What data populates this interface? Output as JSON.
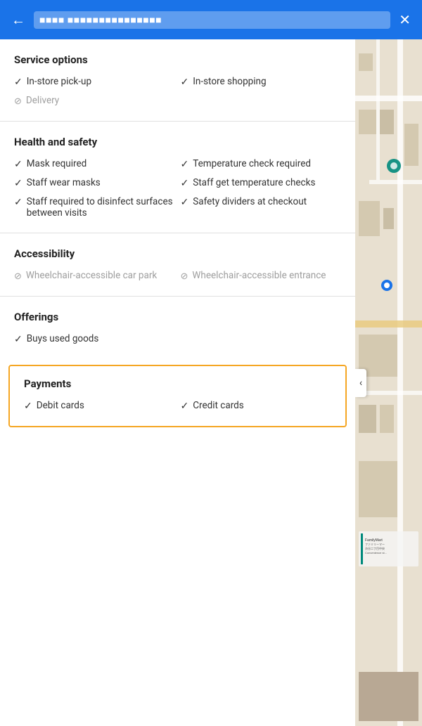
{
  "header": {
    "title": "■■■■ ■■■■■■■■■■■■■■■",
    "back_label": "←",
    "close_label": "✕"
  },
  "sections": [
    {
      "id": "service-options",
      "title": "Service options",
      "layout": "grid",
      "items": [
        {
          "label": "In-store pick-up",
          "available": true
        },
        {
          "label": "In-store shopping",
          "available": true
        },
        {
          "label": "Delivery",
          "available": false
        }
      ]
    },
    {
      "id": "health-safety",
      "title": "Health and safety",
      "layout": "grid",
      "items": [
        {
          "label": "Mask required",
          "available": true
        },
        {
          "label": "Temperature check required",
          "available": true
        },
        {
          "label": "Staff wear masks",
          "available": true
        },
        {
          "label": "Staff get temperature checks",
          "available": true
        },
        {
          "label": "Staff required to disinfect surfaces between visits",
          "available": true
        },
        {
          "label": "Safety dividers at checkout",
          "available": true
        }
      ]
    },
    {
      "id": "accessibility",
      "title": "Accessibility",
      "layout": "grid",
      "items": [
        {
          "label": "Wheelchair-accessible car park",
          "available": false
        },
        {
          "label": "Wheelchair-accessible entrance",
          "available": false
        }
      ]
    },
    {
      "id": "offerings",
      "title": "Offerings",
      "layout": "list",
      "items": [
        {
          "label": "Buys used goods",
          "available": true
        }
      ]
    }
  ],
  "payments": {
    "title": "Payments",
    "items": [
      {
        "label": "Debit cards",
        "available": true
      },
      {
        "label": "Credit cards",
        "available": true
      }
    ]
  },
  "map": {
    "arrow_label": "‹"
  }
}
